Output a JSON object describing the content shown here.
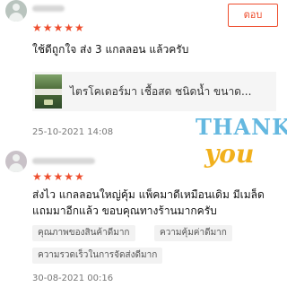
{
  "review1": {
    "reply_label": "ตอบ",
    "stars": "★★★★★",
    "text": "ใช้ดีถูกใจ ส่ง 3 แกลลอน แล้วครับ",
    "product_name": "ไตรโคเดอร์มา เชื้อสด ชนิดน้ำ ขนาด...",
    "date": "25-10-2021 14:08",
    "sticker_line1": "THANK",
    "sticker_line2": "you"
  },
  "review2": {
    "stars": "★★★★★",
    "text_line1": "ส่งไว แกลลอนใหญ่คุ้ม แพ็คมาดีเหมือนเดิม มีเมล็ด",
    "text_line2": "แถมมาอีกแล้ว ขอบคุณทางร้านมากครับ",
    "tags": [
      "คุณภาพของสินค้าดีมาก",
      "ความคุ้มค่าดีมาก",
      "ความรวดเร็วในการจัดส่งดีมาก"
    ],
    "date": "30-08-2021 00:16"
  },
  "colors": {
    "accent": "#ee4d2d",
    "star": "#ee4d2d"
  }
}
